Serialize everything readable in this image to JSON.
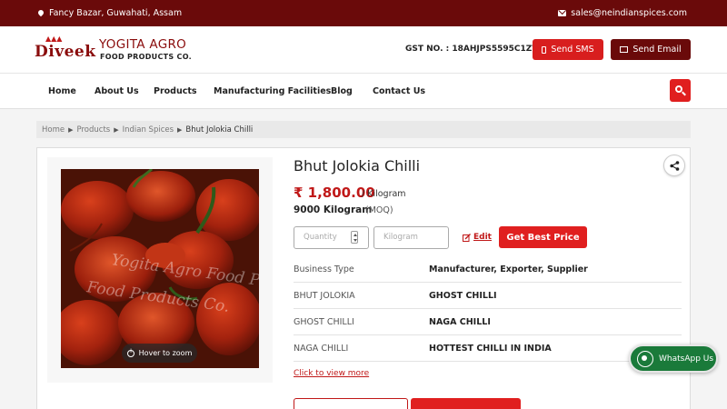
{
  "topbar": {
    "location": "Fancy Bazar, Guwahati, Assam",
    "email": "sales@neindianspices.com"
  },
  "header": {
    "logo_brand": "Diveek",
    "logo_name_line1": "YOGITA AGRO",
    "logo_name_line2": "FOOD PRODUCTS CO.",
    "gst": "GST NO. : 18AHJPS5595C1ZV",
    "sms_label": "Send SMS",
    "email_label": "Send Email"
  },
  "nav": {
    "items": [
      {
        "label": "Home"
      },
      {
        "label": "About Us"
      },
      {
        "label": "Products"
      },
      {
        "label": "Manufacturing Facilities"
      },
      {
        "label": "Blog"
      },
      {
        "label": "Contact Us"
      }
    ]
  },
  "breadcrumb": [
    "Home",
    "Products",
    "Indian Spices",
    "Bhut Jolokia Chilli"
  ],
  "product": {
    "title": "Bhut Jolokia Chilli",
    "currency": "₹",
    "price": "1,800.00",
    "unit": "/ Kilogram",
    "moq_value": "9000 Kilogram",
    "moq_label": "(MOQ)",
    "quantity_placeholder": "Quantity",
    "unit_placeholder": "Kilogram",
    "edit_label": "Edit",
    "best_price_label": "Get Best Price",
    "zoom_hint": "Hover to zoom",
    "image_watermark": "Yogita Agro Food Products Co.",
    "view_more": "Click to view more",
    "specs": [
      {
        "key": "Business Type",
        "value": "Manufacturer, Exporter, Supplier"
      },
      {
        "key": "BHUT JOLOKIA",
        "value": "GHOST CHILLI"
      },
      {
        "key": "GHOST CHILLI",
        "value": "NAGA CHILLI"
      },
      {
        "key": "NAGA CHILLI",
        "value": "HOTTEST CHILLI IN INDIA"
      }
    ]
  },
  "whatsapp": {
    "label": "WhatsApp Us"
  },
  "colors": {
    "maroon": "#6a0a0a",
    "red": "#e01f1f",
    "whatsapp": "#1a7a3a"
  }
}
